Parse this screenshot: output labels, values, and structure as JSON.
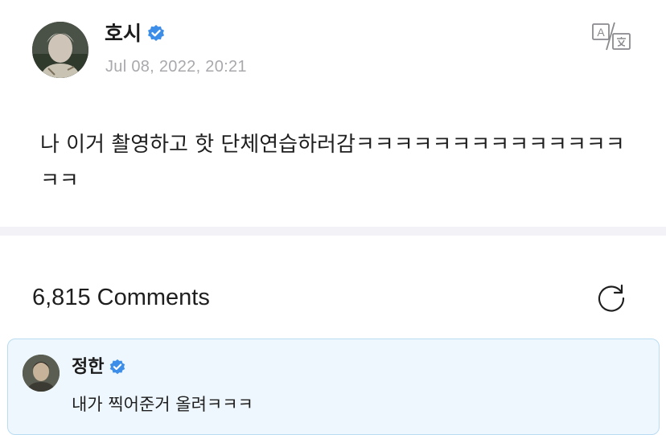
{
  "post": {
    "author_name": "호시",
    "date": "Jul 08, 2022, 20:21",
    "body": "나 이거 촬영하고 핫 단체연습하러감ㅋㅋㅋㅋㅋㅋㅋㅋㅋㅋㅋㅋㅋㅋㅋㅋ",
    "verified_icon": "verified-badge-icon",
    "translate_icon": "translate-icon"
  },
  "comments": {
    "header": "6,815 Comments",
    "refresh_icon": "refresh-icon",
    "items": [
      {
        "author_name": "정한",
        "text": "내가 찍어준거 올려ㅋㅋㅋ",
        "verified_icon": "verified-badge-icon"
      }
    ]
  },
  "colors": {
    "verified": "#3d8ee9",
    "date_gray": "#a9a9ad",
    "divider": "#f3f3f7",
    "comment_bg": "#eef7fd",
    "comment_border": "#b9dcf2"
  }
}
